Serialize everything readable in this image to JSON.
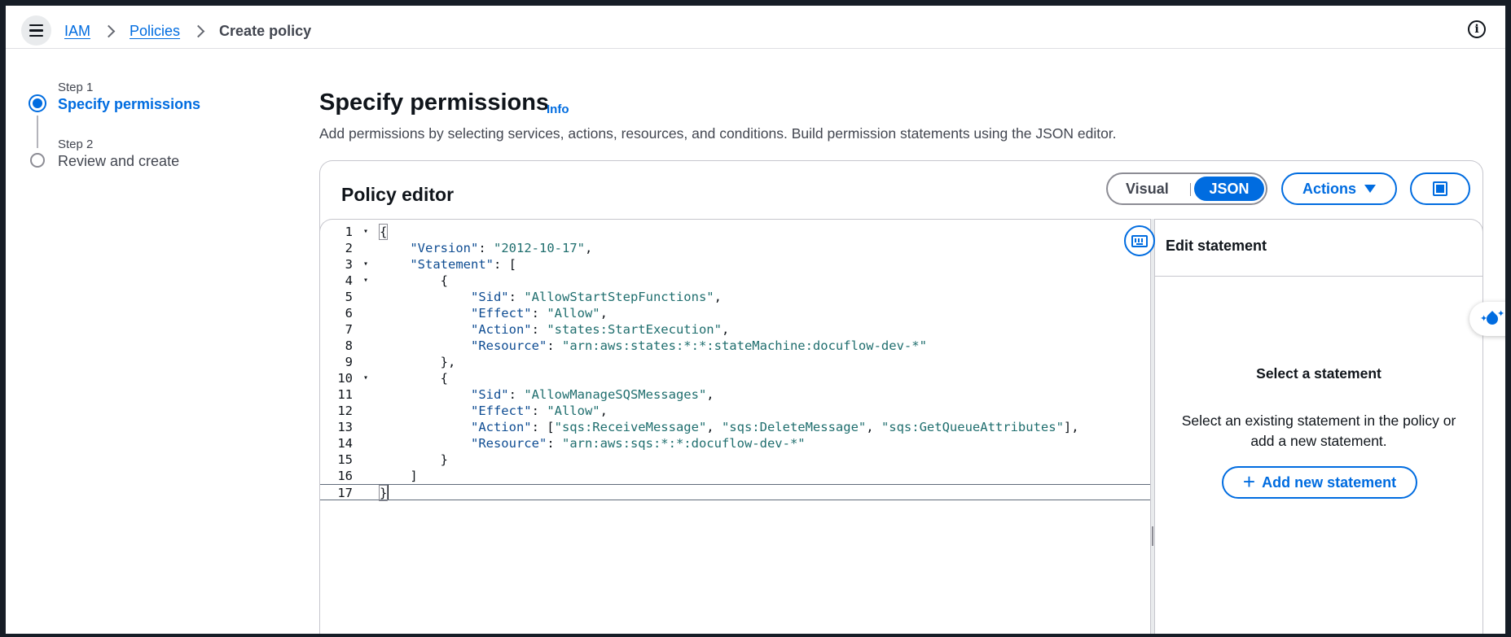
{
  "breadcrumb": {
    "iam": "IAM",
    "policies": "Policies",
    "current": "Create policy"
  },
  "steps": [
    {
      "label": "Step 1",
      "title": "Specify permissions",
      "state": "active"
    },
    {
      "label": "Step 2",
      "title": "Review and create",
      "state": "inactive"
    }
  ],
  "page": {
    "title": "Specify permissions",
    "info": "Info",
    "description": "Add permissions by selecting services, actions, resources, and conditions. Build permission statements using the JSON editor."
  },
  "editor": {
    "title": "Policy editor",
    "mode_visual": "Visual",
    "mode_json": "JSON",
    "selected_mode": "JSON",
    "actions_label": "Actions",
    "code_lines": [
      "{",
      "    \"Version\": \"2012-10-17\",",
      "    \"Statement\": [",
      "        {",
      "            \"Sid\": \"AllowStartStepFunctions\",",
      "            \"Effect\": \"Allow\",",
      "            \"Action\": \"states:StartExecution\",",
      "            \"Resource\": \"arn:aws:states:*:*:stateMachine:docuflow-dev-*\"",
      "        },",
      "        {",
      "            \"Sid\": \"AllowManageSQSMessages\",",
      "            \"Effect\": \"Allow\",",
      "            \"Action\": [\"sqs:ReceiveMessage\", \"sqs:DeleteMessage\", \"sqs:GetQueueAttributes\"],",
      "            \"Resource\": \"arn:aws:sqs:*:*:docuflow-dev-*\"",
      "        }",
      "    ]",
      "}"
    ],
    "foldable_lines": [
      1,
      3,
      4,
      10
    ],
    "current_line": 17
  },
  "side_panel": {
    "title": "Edit statement",
    "empty_title": "Select a statement",
    "empty_desc": "Select an existing statement in the policy or add a new statement.",
    "add_label": "Add new statement"
  },
  "colors": {
    "accent": "#006ce0",
    "frame": "#161d26"
  },
  "icons": [
    "menu-icon",
    "chevron-right-icon",
    "info-icon",
    "caret-down-icon",
    "fullscreen-icon",
    "keyboard-icon",
    "plus-icon",
    "amazon-q-icon"
  ]
}
